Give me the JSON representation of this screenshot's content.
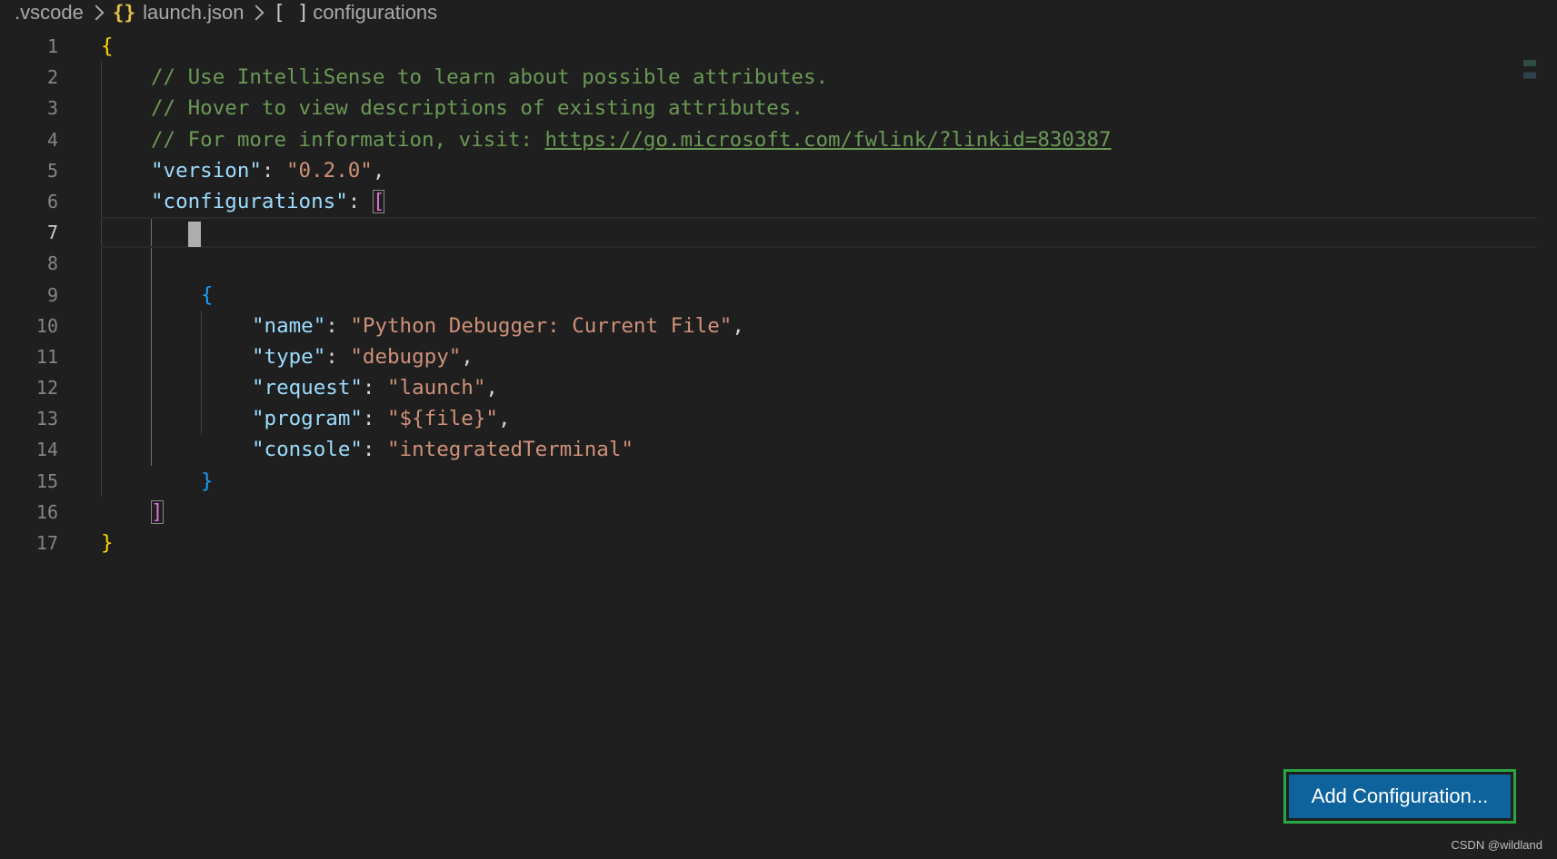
{
  "breadcrumb": {
    "folder": ".vscode",
    "file_icon": "{}",
    "file": "launch.json",
    "symbol_icon": "[ ]",
    "symbol": "configurations"
  },
  "line_numbers": [
    "1",
    "2",
    "3",
    "4",
    "5",
    "6",
    "7",
    "8",
    "9",
    "10",
    "11",
    "12",
    "13",
    "14",
    "15",
    "16",
    "17"
  ],
  "code": {
    "comment1": "// Use IntelliSense to learn about possible attributes.",
    "comment2": "// Hover to view descriptions of existing attributes.",
    "comment3_prefix": "// For more information, visit: ",
    "comment3_link": "https://go.microsoft.com/fwlink/?linkid=830387",
    "version_key": "version",
    "version_value": "\"0.2.0\"",
    "configurations_key": "configurations",
    "name_key": "name",
    "name_value": "\"Python Debugger: Current File\"",
    "type_key": "type",
    "type_value": "\"debugpy\"",
    "request_key": "request",
    "request_value": "\"launch\"",
    "program_key": "program",
    "program_value": "\"${file}\"",
    "console_key": "console",
    "console_value": "\"integratedTerminal\""
  },
  "add_configuration_label": "Add Configuration...",
  "watermark": "CSDN @wildland",
  "colors": {
    "button_bg": "#0e639c",
    "highlight_border": "#29a744",
    "comment": "#6a9955",
    "key": "#9cdcfe",
    "string": "#ce9178"
  }
}
